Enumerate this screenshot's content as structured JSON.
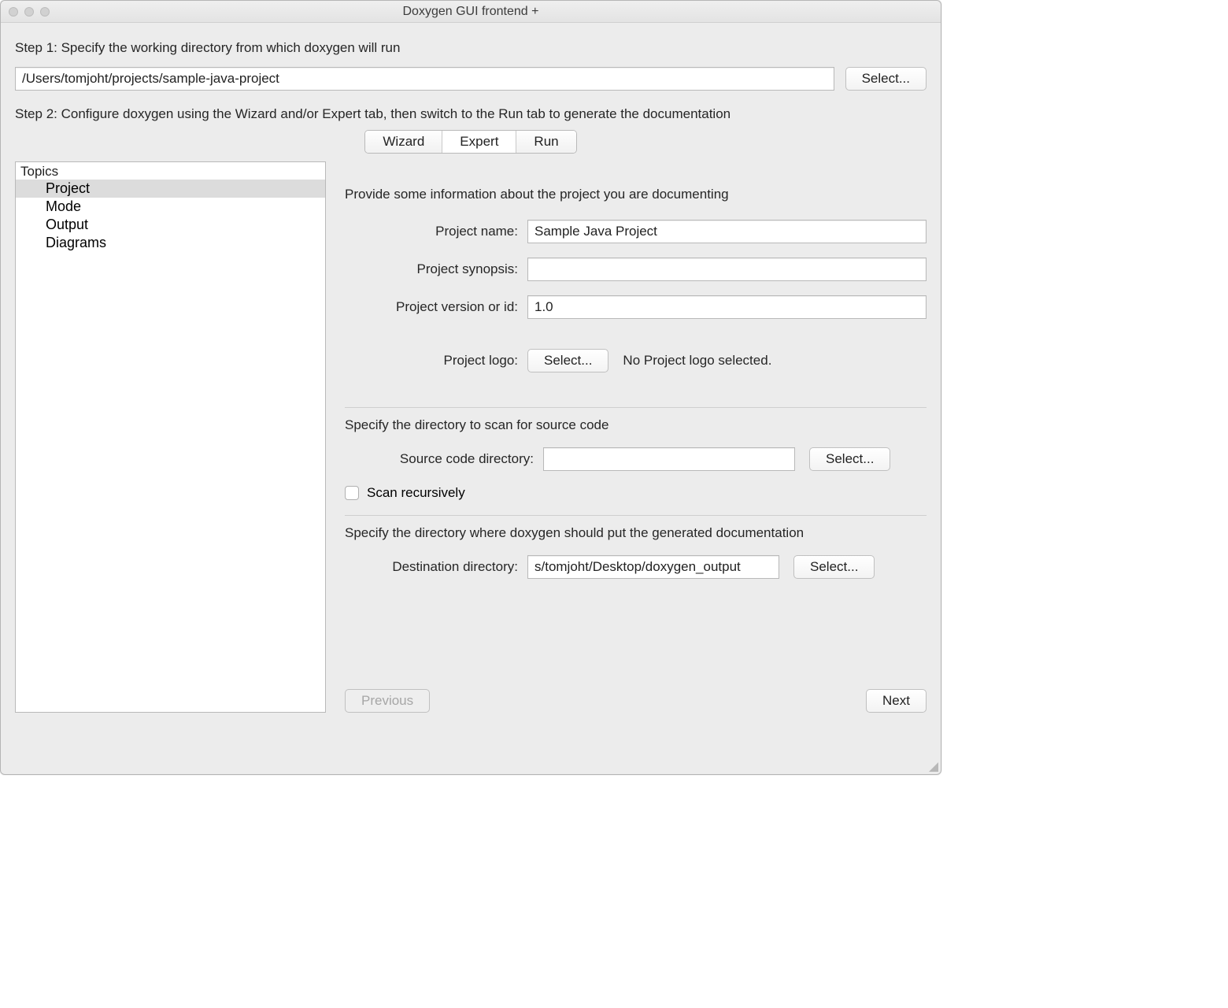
{
  "window": {
    "title": "Doxygen GUI frontend +"
  },
  "step1": {
    "label": "Step 1: Specify the working directory from which doxygen will run",
    "path": "/Users/tomjoht/projects/sample-java-project",
    "select_btn": "Select..."
  },
  "step2": {
    "label": "Step 2: Configure doxygen using the Wizard and/or Expert tab, then switch to the Run tab to generate the documentation"
  },
  "tabs": {
    "wizard": "Wizard",
    "expert": "Expert",
    "run": "Run"
  },
  "topics": {
    "header": "Topics",
    "items": [
      "Project",
      "Mode",
      "Output",
      "Diagrams"
    ]
  },
  "project": {
    "intro": "Provide some information about the project you are documenting",
    "name_label": "Project name:",
    "name_value": "Sample Java Project",
    "synopsis_label": "Project synopsis:",
    "synopsis_value": "",
    "version_label": "Project version or id:",
    "version_value": "1.0",
    "logo_label": "Project logo:",
    "logo_select": "Select...",
    "logo_hint": "No Project logo selected."
  },
  "source": {
    "intro": "Specify the directory to scan for source code",
    "dir_label": "Source code directory:",
    "dir_value": "",
    "select_btn": "Select...",
    "recursive_label": "Scan recursively"
  },
  "dest": {
    "intro": "Specify the directory where doxygen should put the generated documentation",
    "dir_label": "Destination directory:",
    "dir_value": "s/tomjoht/Desktop/doxygen_output",
    "select_btn": "Select..."
  },
  "nav": {
    "prev": "Previous",
    "next": "Next"
  }
}
